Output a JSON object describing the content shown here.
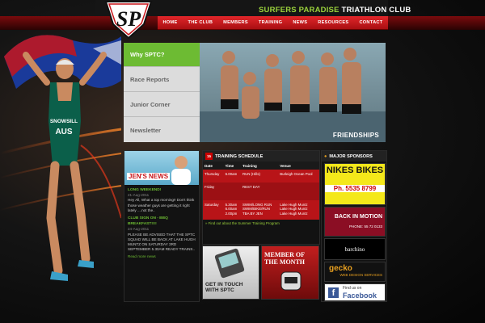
{
  "header": {
    "club_name_part1": "SURFERS PARADISE",
    "club_name_part2": "TRIATHLON CLUB",
    "logo_text": "SP"
  },
  "nav": {
    "items": [
      "HOME",
      "THE CLUB",
      "MEMBERS",
      "TRAINING",
      "NEWS",
      "RESOURCES",
      "CONTACT"
    ],
    "active": "HOME"
  },
  "athlete": {
    "bib_name": "SNOWSILL",
    "country": "AUS"
  },
  "feature_menu": {
    "items": [
      "Why SPTC?",
      "Race Reports",
      "Junior Corner",
      "Newsletter"
    ],
    "active": "Why SPTC?"
  },
  "photo": {
    "caption": "FRIENDSHIPS"
  },
  "jens_news": {
    "title": "JEN'S NEWS",
    "items": [
      {
        "heading": "LONG WEEKEND!",
        "date": "21-Aug-2011",
        "body": "Hey All, What a top morning!! Don't think those weather guys are getting it right lately ....not the.."
      },
      {
        "heading": "CLUB SIGN ON - BBQ BREAKFAST!!!!",
        "date": "24-Aug-2011",
        "body": "PLEASE BE ADVISED THAT THE SPTC SQUAD WILL BE BACK AT LAKE HUGH MUNTZ ON SATURDAY 3RD SEPTEMBER 5.30AM READY TRAINS.."
      }
    ],
    "read_more": "Read more news"
  },
  "schedule": {
    "cal_num": "15",
    "title": "TRAINING SCHEDULE",
    "columns": [
      "Date",
      "Time",
      "Training",
      "Venue"
    ],
    "rows": [
      {
        "day": "Thursday",
        "time": "6.00am",
        "training": "RUN (Hills)",
        "venue": "Burleigh Ocean Pool"
      },
      {
        "day": "Friday",
        "time": "",
        "training": "REST DAY",
        "venue": ""
      },
      {
        "day": "Saturday",
        "time": "5.30am",
        "training": "SWIM/LONG RUN",
        "venue": "Lake Hugh Muntz"
      },
      {
        "day": "",
        "time": "6.00am",
        "training": "SWIM/BIKE/RUN",
        "venue": "Lake Hugh Muntz"
      },
      {
        "day": "",
        "time": "2.00pm",
        "training": "TBA BY JEN",
        "venue": "Lake Hugh Muntz"
      }
    ],
    "link": "» Find out about the Summer Training Program"
  },
  "promos": {
    "get_in_touch": "GET IN TOUCH WITH SPTC",
    "member_of_month": "MEMBER OF THE MONTH"
  },
  "sponsors": {
    "title": "MAJOR SPONSORS",
    "nikes_bikes": "NIKES BIKES",
    "nikes_phone": "Ph. 5535 8799",
    "back_in_motion": "BACK IN MOTION",
    "back_phone": "PHONE: 55 72 0133",
    "barchino": "barchino",
    "gecko": "gecko",
    "gecko_sub": "WEB DESIGN SERVICES",
    "facebook_find": "Find us on",
    "facebook": "Facebook"
  },
  "colors": {
    "accent_green": "#6dbb33",
    "nav_red": "#d01e22",
    "title_green": "#9ad23c"
  }
}
